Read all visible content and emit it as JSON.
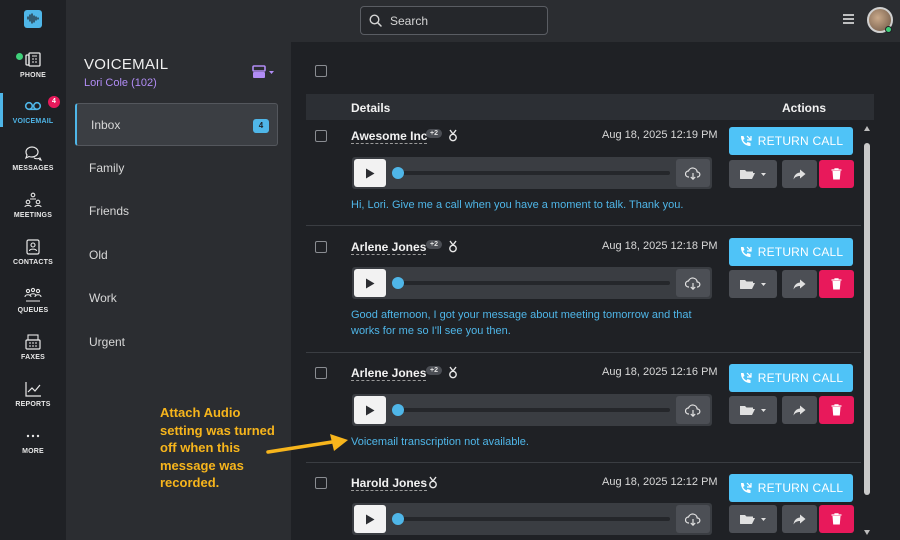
{
  "nav": {
    "items": [
      {
        "label": "PHONE",
        "icon": "phone-icon"
      },
      {
        "label": "VOICEMAIL",
        "icon": "voicemail-icon",
        "badge": "4",
        "active": true
      },
      {
        "label": "MESSAGES",
        "icon": "messages-icon"
      },
      {
        "label": "MEETINGS",
        "icon": "meetings-icon"
      },
      {
        "label": "CONTACTS",
        "icon": "contacts-icon"
      },
      {
        "label": "QUEUES",
        "icon": "queues-icon"
      },
      {
        "label": "FAXES",
        "icon": "faxes-icon"
      },
      {
        "label": "REPORTS",
        "icon": "reports-icon"
      },
      {
        "label": "MORE",
        "icon": "more-icon"
      }
    ]
  },
  "topbar": {
    "search_label": "Search"
  },
  "voicemail": {
    "title": "VOICEMAIL",
    "user": "Lori Cole (102)",
    "folders": [
      {
        "label": "Inbox",
        "badge": "4",
        "active": true
      },
      {
        "label": "Family"
      },
      {
        "label": "Friends"
      },
      {
        "label": "Old"
      },
      {
        "label": "Work"
      },
      {
        "label": "Urgent"
      }
    ]
  },
  "table": {
    "col_details": "Details",
    "col_actions": "Actions",
    "return_label": "RETURN CALL",
    "rows": [
      {
        "name": "Awesome Inc",
        "count": "+2",
        "date": "Aug 18, 2025 12:19 PM",
        "transcript": "Hi, Lori. Give me a call when you have a moment to talk. Thank you."
      },
      {
        "name": "Arlene Jones",
        "count": "+2",
        "date": "Aug 18, 2025 12:18 PM",
        "transcript": "Good afternoon, I got your message about meeting tomorrow and that works for me so I'll see you then."
      },
      {
        "name": "Arlene Jones",
        "count": "+2",
        "date": "Aug 18, 2025 12:16 PM",
        "transcript": "Voicemail transcription not available."
      },
      {
        "name": "Harold Jones",
        "count": "",
        "date": "Aug 18, 2025 12:12 PM",
        "transcript": ""
      }
    ]
  },
  "annotation": {
    "text_lines": [
      "Attach Audio",
      "setting was turned",
      "off when this",
      "message was",
      "recorded."
    ]
  },
  "colors": {
    "accent": "#4fb6e8",
    "delete": "#e8195b",
    "annotation": "#f7b51c",
    "user_purple": "#b18cf5"
  }
}
